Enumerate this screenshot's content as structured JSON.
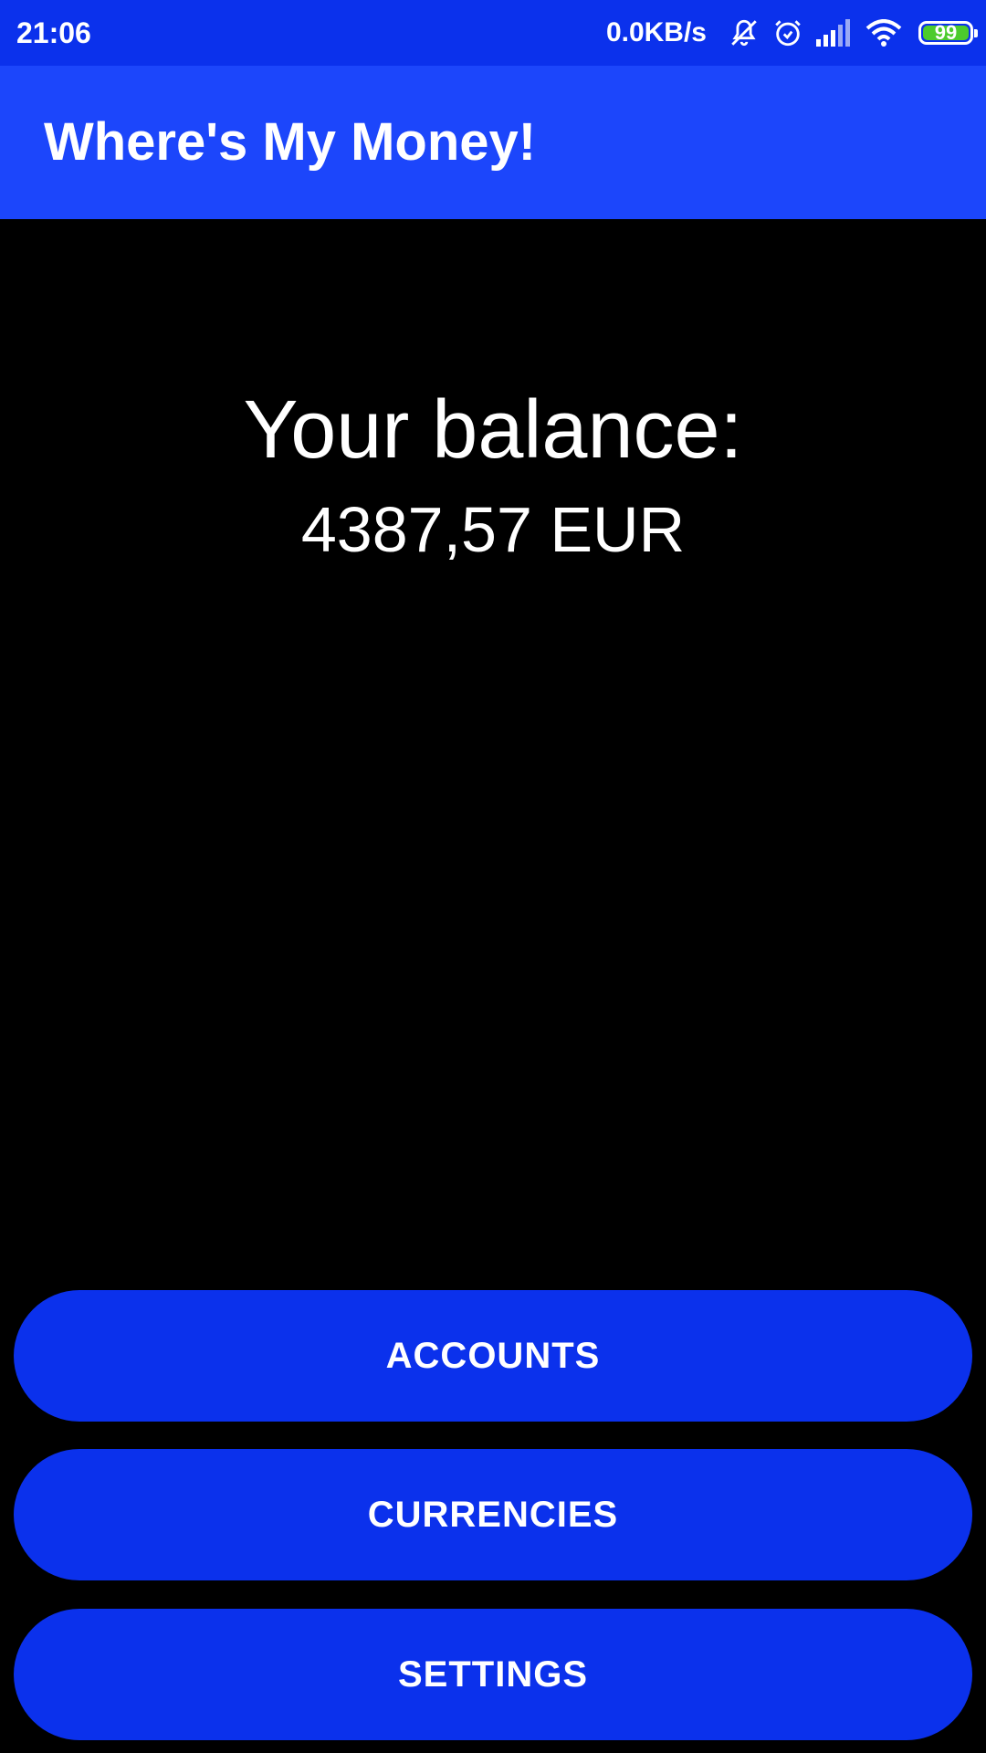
{
  "status_bar": {
    "time": "21:06",
    "net_speed": "0.0KB/s",
    "battery_percent": "99",
    "battery_color": "#4ccb2d",
    "icons": [
      "bell-off-icon",
      "alarm-icon",
      "signal-icon",
      "wifi-icon",
      "battery-icon"
    ]
  },
  "app_bar": {
    "title": "Where's My Money!",
    "color": "#1c46fb"
  },
  "main": {
    "balance_label": "Your balance:",
    "balance_value": "4387,57 EUR"
  },
  "buttons": {
    "accounts": "ACCOUNTS",
    "currencies": "CURRENCIES",
    "settings": "SETTINGS",
    "color": "#0b31ec"
  }
}
